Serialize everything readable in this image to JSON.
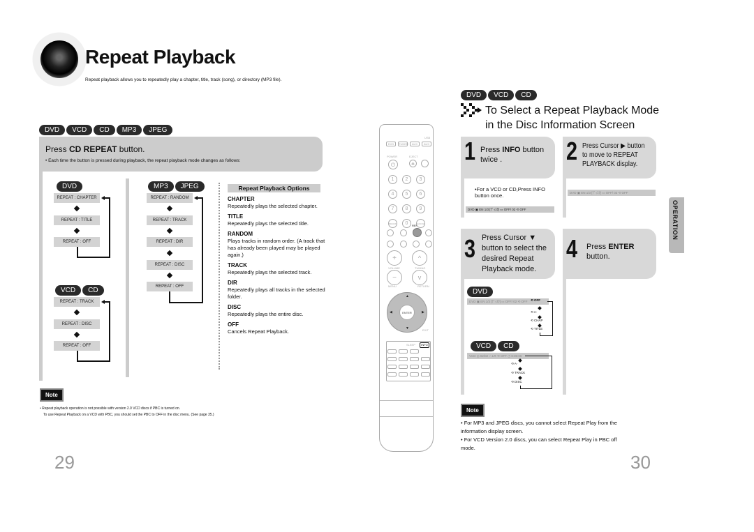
{
  "header": {
    "title": "Repeat Playback",
    "intro": "Repeat playback allows you to repeatedly play a chapter, title, track (song), or directory (MP3 file)."
  },
  "left_page": {
    "disc_badges": [
      "DVD",
      "VCD",
      "CD",
      "MP3",
      "JPEG"
    ],
    "step": {
      "prefix": "Press ",
      "button": "CD REPEAT",
      "suffix": " button.",
      "sub": "• Each time the button is pressed during playback, the repeat playback mode changes as follows:"
    },
    "flows": {
      "dvd": {
        "badges": [
          "DVD"
        ],
        "items": [
          "REPEAT : CHAPTER",
          "REPEAT : TITLE",
          "REPEAT : OFF"
        ]
      },
      "vcd_cd": {
        "badges": [
          "VCD",
          "CD"
        ],
        "items": [
          "REPEAT : TRACK",
          "REPEAT : DISC",
          "REPEAT : OFF"
        ]
      },
      "mp3_jpeg": {
        "badges": [
          "MP3",
          "JPEG"
        ],
        "items": [
          "REPEAT : RANDOM",
          "REPEAT : TRACK",
          "REPEAT : DIR",
          "REPEAT : DISC",
          "REPEAT : OFF"
        ]
      }
    },
    "options": {
      "heading": "Repeat Playback Options",
      "items": [
        {
          "key": "CHAPTER",
          "desc": "Repeatedly plays the selected chapter."
        },
        {
          "key": "TITLE",
          "desc": "Repeatedly plays the selected title."
        },
        {
          "key": "RANDOM",
          "desc": "Plays tracks in random order. (A track that has already been played may be played again.)"
        },
        {
          "key": "TRACK",
          "desc": "Repeatedly plays the selected track."
        },
        {
          "key": "DIR",
          "desc": "Repeatedly plays all tracks in the selected folder."
        },
        {
          "key": "DISC",
          "desc": "Repeatedly plays the entire disc."
        },
        {
          "key": "OFF",
          "desc": "Cancels Repeat Playback."
        }
      ]
    },
    "note": {
      "label": "Note",
      "line1": "• Repeat playback operation is not possible with version 2.0 VCD discs if PBC is turned on.",
      "line2": "To use Repeat Playback on a VCD with PBC, you should set the PBC to OFF in the disc menu. (See page 35.)"
    },
    "page_number": "29"
  },
  "remote": {
    "top_keys": [
      "DVD",
      "TUNER",
      "AUX",
      "AUX"
    ],
    "top_labels": [
      "USB"
    ],
    "power": "POWER",
    "eject": "EJECT",
    "dimmer": "DIMMER",
    "digits": [
      "1",
      "2",
      "3",
      "4",
      "5",
      "6",
      "7",
      "8",
      "9",
      "REMAIN",
      "0",
      "CANCEL"
    ],
    "repeat_label": "REPEAT",
    "stop": "STOP",
    "play": "PLAY",
    "mute": "MUTE",
    "volume": "VOLUME",
    "tuning": "TUNING",
    "menu": "MENU",
    "return": "RETURN",
    "enter": "ENTER",
    "exit": "EXIT",
    "info": "INFO",
    "sleep": "SLEEP"
  },
  "right_page": {
    "disc_badges": [
      "DVD",
      "VCD",
      "CD"
    ],
    "section_title_line1": "To Select a Repeat Playback Mode",
    "section_title_line2": "in the Disc Information Screen",
    "steps": [
      {
        "num": "1",
        "pre": "Press ",
        "bold": "INFO",
        "post": " button twice ."
      },
      {
        "num": "2",
        "pre": "Press Cursor ",
        "glyph": "▶",
        "post": " button to move to REPEAT PLAYBACK display."
      },
      {
        "num": "3",
        "pre": "Press Cursor ",
        "glyph": "▼",
        "post": " button to select the desired Repeat Playback mode."
      },
      {
        "num": "4",
        "pre": "Press ",
        "bold": "ENTER",
        "post": " button."
      }
    ],
    "step1_note": "•For a VCD or CD,Press INFO button once.",
    "osd_dvd": "DVD  ▣ EN 1/3  [ﾃﾞｨｽｸ]  ▭ OFF/ 02   ⟲ OFF",
    "osd_vcd": "VCD  ◎ 02/02   ∩ LR   ⟲ OFF  ◷ 0:00:00",
    "dvd_badge": "DVD",
    "vcd_badges": [
      "VCD",
      "CD"
    ],
    "dvd_modes": [
      "OFF",
      "A-",
      "CHAP",
      "TITLE"
    ],
    "vcd_modes": [
      "OFF",
      "A-",
      "TRACK",
      "DISC"
    ],
    "side_tab": "OPERATION",
    "note": {
      "label": "Note",
      "items": [
        "• For MP3 and JPEG discs, you cannot select Repeat Play from the information display screen.",
        "• For VCD Version 2.0 discs, you can select Repeat Play in PBC off mode."
      ]
    },
    "page_number": "30"
  }
}
